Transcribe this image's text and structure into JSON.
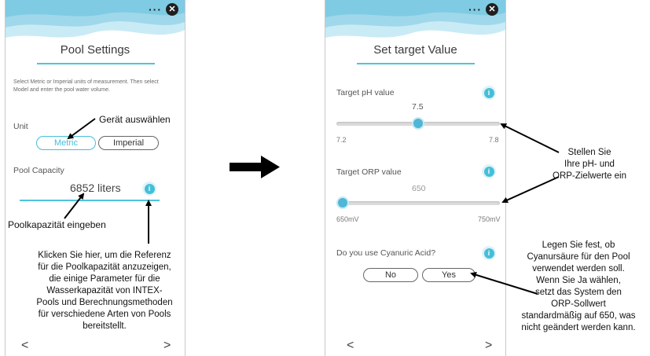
{
  "left_phone": {
    "title": "Pool Settings",
    "description": "Select Metric or Imperial units of measurement. Then select Model and enter the pool water volume.",
    "unit_label": "Unit",
    "metric_button": "Metric",
    "imperial_button": "Imperial",
    "selected_unit": "Metric",
    "capacity_label": "Pool Capacity",
    "capacity_value": "6852 liters",
    "info_glyph": "i",
    "more_glyph": "···",
    "close_glyph": "✕",
    "prev_glyph": "<",
    "next_glyph": ">"
  },
  "right_phone": {
    "title": "Set target Value",
    "ph_label": "Target pH value",
    "ph_value": "7.5",
    "ph_min": "7.2",
    "ph_max": "7.8",
    "ph_position": 0.5,
    "orp_label": "Target ORP value",
    "orp_value": "650",
    "orp_min": "650mV",
    "orp_max": "750mV",
    "orp_position": 0.0,
    "cya_question": "Do you use Cyanuric Acid?",
    "no_button": "No",
    "yes_button": "Yes",
    "info_glyph": "i",
    "more_glyph": "···",
    "close_glyph": "✕",
    "prev_glyph": "<",
    "next_glyph": ">"
  },
  "annotations": {
    "select_device": "Gerät auswählen",
    "enter_capacity": "Poolkapazität eingeben",
    "reference_lines": [
      "Klicken Sie hier, um die Referenz",
      "für die Poolkapazität anzuzeigen,",
      "die einige Parameter für die",
      "Wasserkapazität von INTEX-",
      "Pools und Berechnungsmethoden",
      "für verschiedene Arten von Pools",
      "bereitstellt."
    ],
    "targets_lines": [
      "Stellen Sie",
      "Ihre pH- und",
      "ORP-Zielwerte ein"
    ],
    "cya_lines": [
      "Legen Sie fest, ob",
      "Cyanursäure für den Pool",
      "verwendet werden soll.",
      "Wenn Sie Ja wählen,",
      "setzt das System den",
      "ORP-Sollwert",
      "standardmäßig auf 650, was",
      "nicht geändert werden kann."
    ]
  },
  "colors": {
    "accent": "#45bfd9",
    "wave_light": "#bfe6f2",
    "wave_mid": "#8ad0e6",
    "text_dark": "#333333"
  }
}
